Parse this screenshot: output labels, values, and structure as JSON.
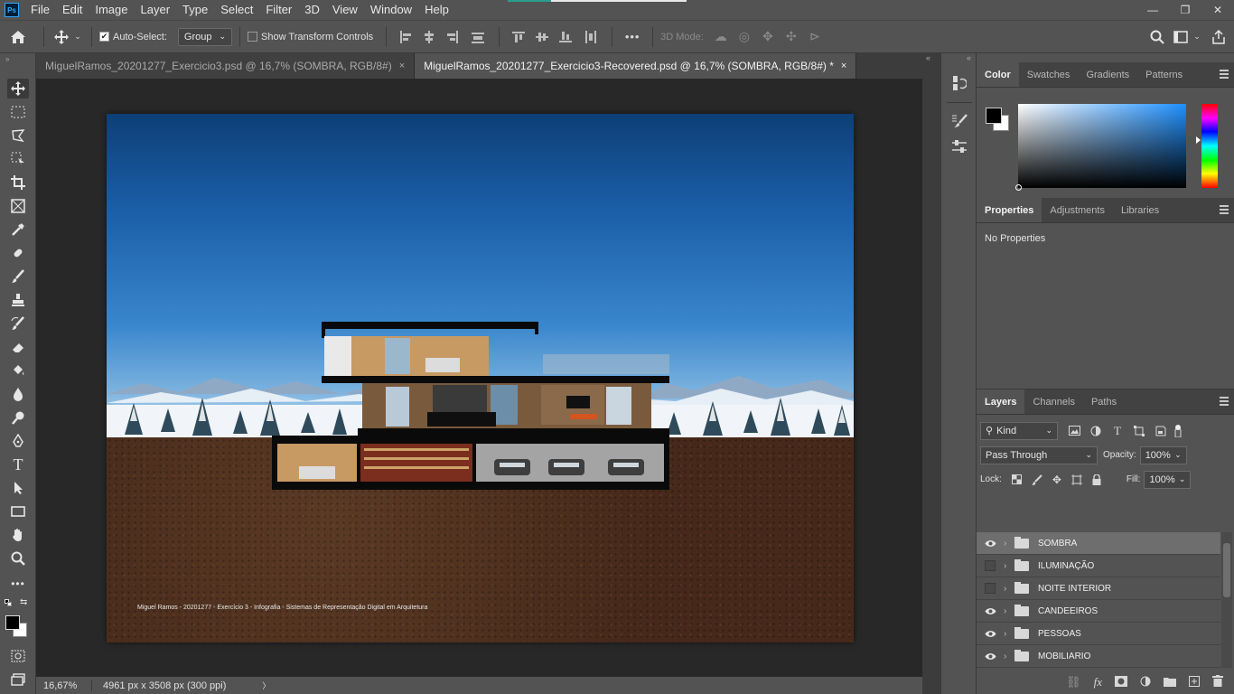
{
  "app": {
    "logo": "Ps"
  },
  "menu": [
    "File",
    "Edit",
    "Image",
    "Layer",
    "Type",
    "Select",
    "Filter",
    "3D",
    "View",
    "Window",
    "Help"
  ],
  "window_controls": {
    "minimize": "—",
    "restore": "❐",
    "close": "✕"
  },
  "options_bar": {
    "auto_select_label": "Auto-Select:",
    "auto_select_checked": true,
    "auto_select_target": "Group",
    "transform_label": "Show Transform Controls",
    "transform_checked": false,
    "more": "•••",
    "mode_3d_label": "3D Mode:"
  },
  "tabs": [
    {
      "title": "MiguelRamos_20201277_Exercicio3.psd @ 16,7% (SOMBRA, RGB/8#)",
      "active": false,
      "close": "×"
    },
    {
      "title": "MiguelRamos_20201277_Exercicio3-Recovered.psd @ 16,7% (SOMBRA, RGB/8#) *",
      "active": true,
      "close": "×"
    }
  ],
  "canvas": {
    "caption": "Miguel Ramos - 20201277 - Exercício 3 - Infografia - Sistemas de Representação Digital em Arquitetura",
    "colors": {
      "sky_top": "#0d3f77",
      "sky_bottom": "#cfe3f2",
      "ground": "#4a2e1e"
    }
  },
  "status": {
    "zoom": "16,67%",
    "dimensions": "4961 px x 3508 px (300 ppi)",
    "arrow": "〉"
  },
  "color_panel": {
    "tabs": [
      "Color",
      "Swatches",
      "Gradients",
      "Patterns"
    ],
    "active_tab": "Color",
    "foreground": "#000000",
    "background": "#ffffff"
  },
  "properties_panel": {
    "tabs": [
      "Properties",
      "Adjustments",
      "Libraries"
    ],
    "active_tab": "Properties",
    "empty_text": "No Properties"
  },
  "layers_panel": {
    "tabs": [
      "Layers",
      "Channels",
      "Paths"
    ],
    "active_tab": "Layers",
    "filter_kind": "Kind",
    "blend_mode": "Pass Through",
    "opacity_label": "Opacity:",
    "opacity": "100%",
    "lock_label": "Lock:",
    "fill_label": "Fill:",
    "fill": "100%",
    "layers": [
      {
        "name": "SOMBRA",
        "visible": true,
        "selected": true
      },
      {
        "name": "ILUMINAÇÃO",
        "visible": false,
        "selected": false
      },
      {
        "name": "NOITE INTERIOR",
        "visible": false,
        "selected": false
      },
      {
        "name": "CANDEEIROS",
        "visible": true,
        "selected": false
      },
      {
        "name": "PESSOAS",
        "visible": true,
        "selected": false
      },
      {
        "name": "MOBILIARIO",
        "visible": true,
        "selected": false
      }
    ]
  }
}
